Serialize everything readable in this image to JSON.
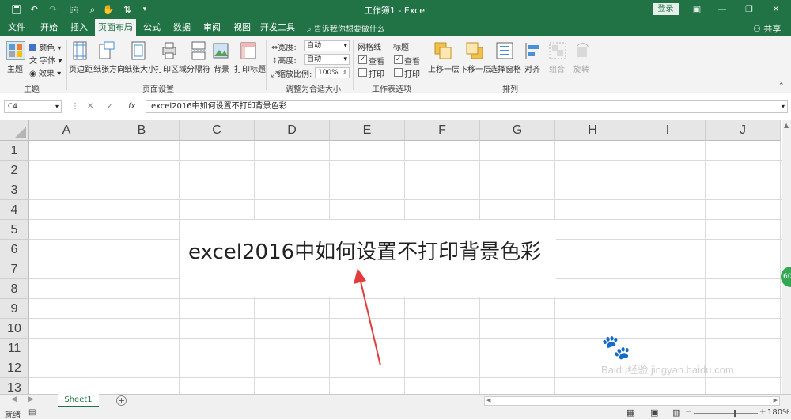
{
  "title_bar": {
    "title": "工作簿1 - Excel",
    "login_label": "登录"
  },
  "ribbon_tabs": [
    {
      "label": "文件"
    },
    {
      "label": "开始"
    },
    {
      "label": "插入"
    },
    {
      "label": "页面布局",
      "active": true
    },
    {
      "label": "公式"
    },
    {
      "label": "数据"
    },
    {
      "label": "审阅"
    },
    {
      "label": "视图"
    },
    {
      "label": "开发工具"
    }
  ],
  "tell_me": "告诉我你想要做什么",
  "share_label": "共享",
  "ribbon": {
    "theme_group": {
      "theme_label": "主题",
      "colors_label": "颜色",
      "fonts_label": "字体",
      "effects_label": "效果",
      "group_label": "主题"
    },
    "page_setup": {
      "margins": "页边距",
      "orientation": "纸张方向",
      "size": "纸张大小",
      "print_area": "打印区域",
      "breaks": "分隔符",
      "background": "背景",
      "print_titles": "打印标题",
      "group_label": "页面设置"
    },
    "scale": {
      "width_label": "宽度:",
      "width_value": "自动",
      "height_label": "高度:",
      "height_value": "自动",
      "scale_label": "缩放比例:",
      "scale_value": "100%",
      "group_label": "调整为合适大小"
    },
    "sheet_options": {
      "gridlines_label": "网格线",
      "headings_label": "标题",
      "view_label": "查看",
      "print_label": "打印",
      "gridlines_view": true,
      "gridlines_print": false,
      "headings_view": true,
      "headings_print": false,
      "group_label": "工作表选项"
    },
    "arrange": {
      "bring_forward": "上移一层",
      "send_backward": "下移一层",
      "selection_pane": "选择窗格",
      "align": "对齐",
      "group": "组合",
      "rotate": "旋转",
      "group_label": "排列"
    }
  },
  "formula_bar": {
    "name_box": "C4",
    "value": "excel2016中如何设置不打印背景色彩"
  },
  "grid": {
    "columns": [
      "A",
      "B",
      "C",
      "D",
      "E",
      "F",
      "G",
      "H",
      "I",
      "J"
    ],
    "rows": [
      "1",
      "2",
      "3",
      "4",
      "5",
      "6",
      "7",
      "8",
      "9",
      "10",
      "11",
      "12",
      "13"
    ],
    "overlay_text": "excel2016中如何设置不打印背景色彩"
  },
  "sheet_tabs": [
    {
      "label": "Sheet1"
    }
  ],
  "add_sheet_label": "+",
  "status": {
    "ready": "就绪",
    "zoom": "180%"
  },
  "badge": "60",
  "watermark": "Baidu经验 jingyan.baidu.com",
  "colors": {
    "excel_green": "#217346",
    "arrow_red": "#e23b3b"
  }
}
